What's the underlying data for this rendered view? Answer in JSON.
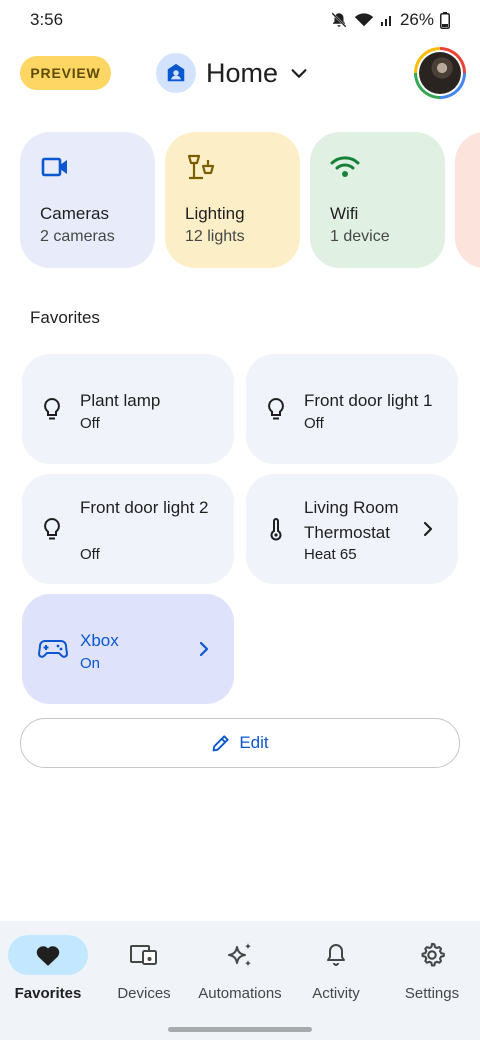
{
  "status_bar": {
    "time": "3:56",
    "battery": "26%"
  },
  "header": {
    "preview_badge": "PREVIEW",
    "home_title": "Home"
  },
  "categories": [
    {
      "title": "Cameras",
      "subtitle": "2 cameras",
      "icon": "videocam-icon",
      "color": "#e8ecfa"
    },
    {
      "title": "Lighting",
      "subtitle": "12 lights",
      "icon": "lamp-icon",
      "color": "#fcefc7"
    },
    {
      "title": "Wifi",
      "subtitle": "1 device",
      "icon": "wifi-icon",
      "color": "#e0f1e4"
    },
    {
      "title": "",
      "subtitle": "",
      "icon": "",
      "color": "#fce3dc"
    }
  ],
  "favorites": {
    "section_title": "Favorites",
    "tiles": [
      {
        "name": "Plant lamp",
        "state": "Off",
        "icon": "lightbulb-icon"
      },
      {
        "name": "Front door light 1",
        "state": "Off",
        "icon": "lightbulb-icon"
      },
      {
        "name": "Front door light 2",
        "state": "Off",
        "icon": "lightbulb-icon"
      },
      {
        "name": "Living Room Thermostat",
        "state": "Heat 65",
        "icon": "thermometer-icon"
      },
      {
        "name": "Xbox",
        "state": "On",
        "icon": "gamepad-icon"
      }
    ],
    "edit_label": "Edit"
  },
  "bottom_nav": [
    {
      "label": "Favorites",
      "icon": "heart-icon",
      "selected": true
    },
    {
      "label": "Devices",
      "icon": "devices-icon",
      "selected": false
    },
    {
      "label": "Automations",
      "icon": "sparkle-icon",
      "selected": false
    },
    {
      "label": "Activity",
      "icon": "bell-icon",
      "selected": false
    },
    {
      "label": "Settings",
      "icon": "gear-icon",
      "selected": false
    }
  ],
  "colors": {
    "accent": "#0b57d0",
    "preview_badge": "#fdd663",
    "nav_selected": "#c2e7ff",
    "tile_background": "#f0f3fa",
    "active_tile_background": "#dfe2fb"
  }
}
